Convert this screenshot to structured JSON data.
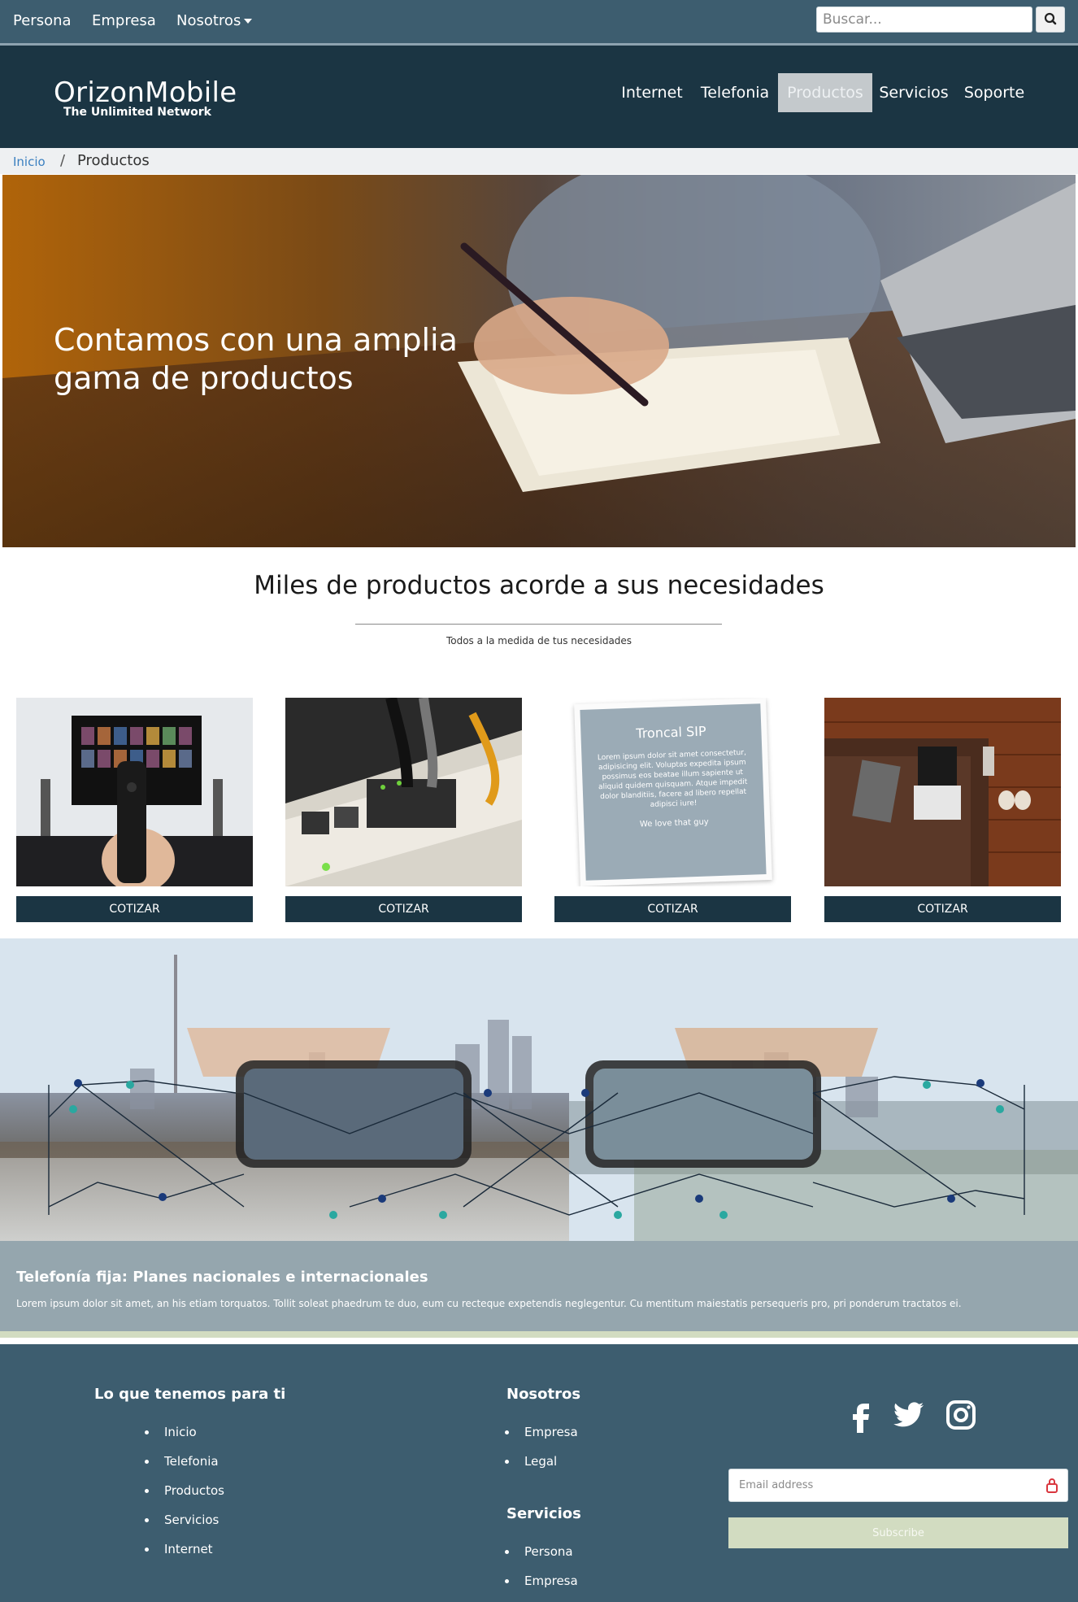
{
  "topnav": {
    "items": [
      "Persona",
      "Empresa",
      "Nosotros"
    ],
    "search_placeholder": "Buscar..."
  },
  "brand": {
    "name": "OrizonMobile",
    "tagline": "The Unlimited Network"
  },
  "mainnav": {
    "items": [
      "Internet",
      "Telefonia",
      "Productos",
      "Servicios",
      "Soporte"
    ],
    "active": "Productos"
  },
  "breadcrumb": {
    "home": "Inicio",
    "separator": "/",
    "current": "Productos"
  },
  "hero": {
    "title": "Contamos con una amplia gama de productos"
  },
  "section": {
    "title": "Miles de productos acorde a sus necesidades",
    "subtitle": "Todos a la medida de tus necesidades"
  },
  "cards": [
    {
      "image": "tv-remote-photo",
      "button": "COTIZAR"
    },
    {
      "image": "network-switch-photo",
      "button": "COTIZAR"
    },
    {
      "image": "troncal-sip-card",
      "button": "COTIZAR",
      "card_title": "Troncal SIP",
      "card_text": "Lorem ipsum dolor sit amet consectetur, adipisicing elit. Voluptas expedita ipsum possimus eos beatae illum sapiente ut aliquid quidem quisquam. Atque impedit dolor blanditiis, facere ad libero repellat adipisci iure!",
      "card_footer": "We love that guy"
    },
    {
      "image": "laptop-sofa-photo",
      "button": "COTIZAR"
    }
  ],
  "banner": {
    "title": "Telefonía fija: Planes nacionales e internacionales",
    "text": "Lorem ipsum dolor sit amet, an his etiam torquatos. Tollit soleat phaedrum te duo, eum cu recteque expetendis neglegentur. Cu mentitum maiestatis persequeris pro, pri ponderum tractatos ei."
  },
  "footer": {
    "col1": {
      "heading": "Lo que tenemos para ti",
      "items": [
        "Inicio",
        "Telefonia",
        "Productos",
        "Servicios",
        "Internet"
      ]
    },
    "col2": {
      "heading": "Nosotros",
      "items": [
        "Empresa",
        "Legal"
      ]
    },
    "col3": {
      "heading": "Servicios",
      "items": [
        "Persona",
        "Empresa"
      ]
    },
    "social": [
      "facebook-icon",
      "twitter-icon",
      "instagram-icon"
    ],
    "email_placeholder": "Email address",
    "subscribe_label": "Subscribe"
  },
  "colors": {
    "topbar": "#3d5d6f",
    "navbar": "#1b3543",
    "button": "#1b3543",
    "accent_green": "#d2dcc1"
  }
}
